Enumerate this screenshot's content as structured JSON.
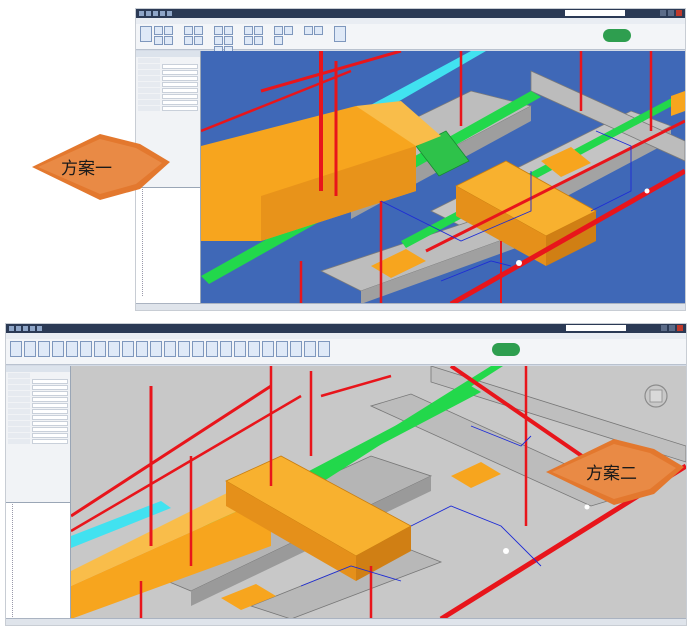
{
  "callouts": [
    {
      "label": "方案一",
      "color": "#e3782e"
    },
    {
      "label": "方案二",
      "color": "#e3782e"
    }
  ],
  "colors": {
    "duct_yellow": "#f7a51e",
    "duct_gray": "#bdbdbd",
    "pipe_red": "#e8151b",
    "pipe_green": "#22d84b",
    "pipe_cyan": "#41e2f0",
    "pipe_blue_outline": "#1d2bd6",
    "viewport_blue": "#3f68b7",
    "viewport_gray": "#c8c8c8"
  },
  "screenshot_1": {
    "viewport_background": "blue"
  },
  "screenshot_2": {
    "viewport_background": "gray"
  }
}
